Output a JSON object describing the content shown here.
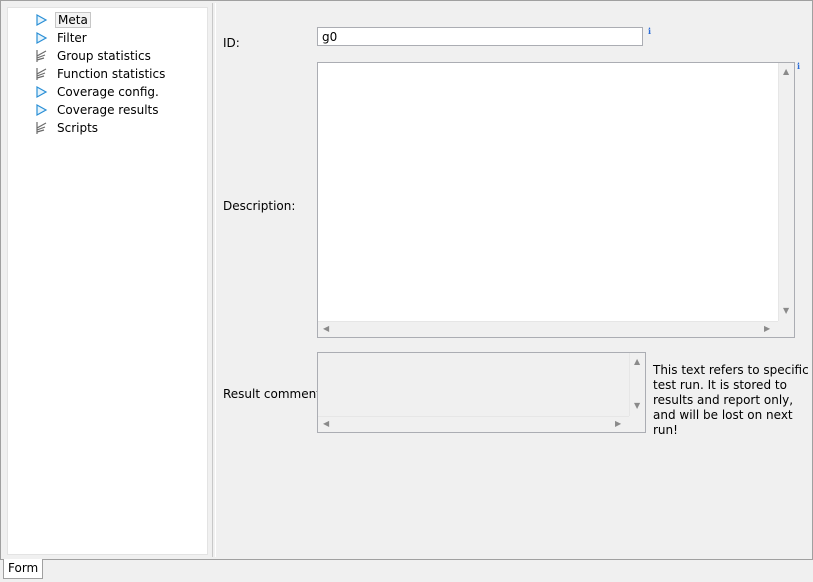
{
  "tree": {
    "items": [
      {
        "label": "Meta",
        "icon": "triangle-outline-blue-icon"
      },
      {
        "label": "Filter",
        "icon": "triangle-outline-blue-icon"
      },
      {
        "label": "Group statistics",
        "icon": "chart-pen-icon"
      },
      {
        "label": "Function statistics",
        "icon": "chart-pen-icon"
      },
      {
        "label": "Coverage config.",
        "icon": "triangle-outline-blue-icon"
      },
      {
        "label": "Coverage results",
        "icon": "triangle-outline-blue-icon"
      },
      {
        "label": "Scripts",
        "icon": "chart-pen-icon"
      }
    ],
    "selected_index": 0
  },
  "form": {
    "id_label": "ID:",
    "id_value": "g0",
    "description_label": "Description:",
    "description_value": "",
    "result_comment_label": "Result comment:",
    "result_comment_value": "",
    "info_marker": "i",
    "note_lines": [
      "This text refers to specific",
      "test run. It is stored to",
      "results and report only,",
      "and will be lost on next run!"
    ]
  },
  "tabs": [
    {
      "label": "Form",
      "active": true
    }
  ],
  "colors": {
    "icon_blue": "#2a8fd6",
    "icon_gray": "#6b6b6b"
  }
}
